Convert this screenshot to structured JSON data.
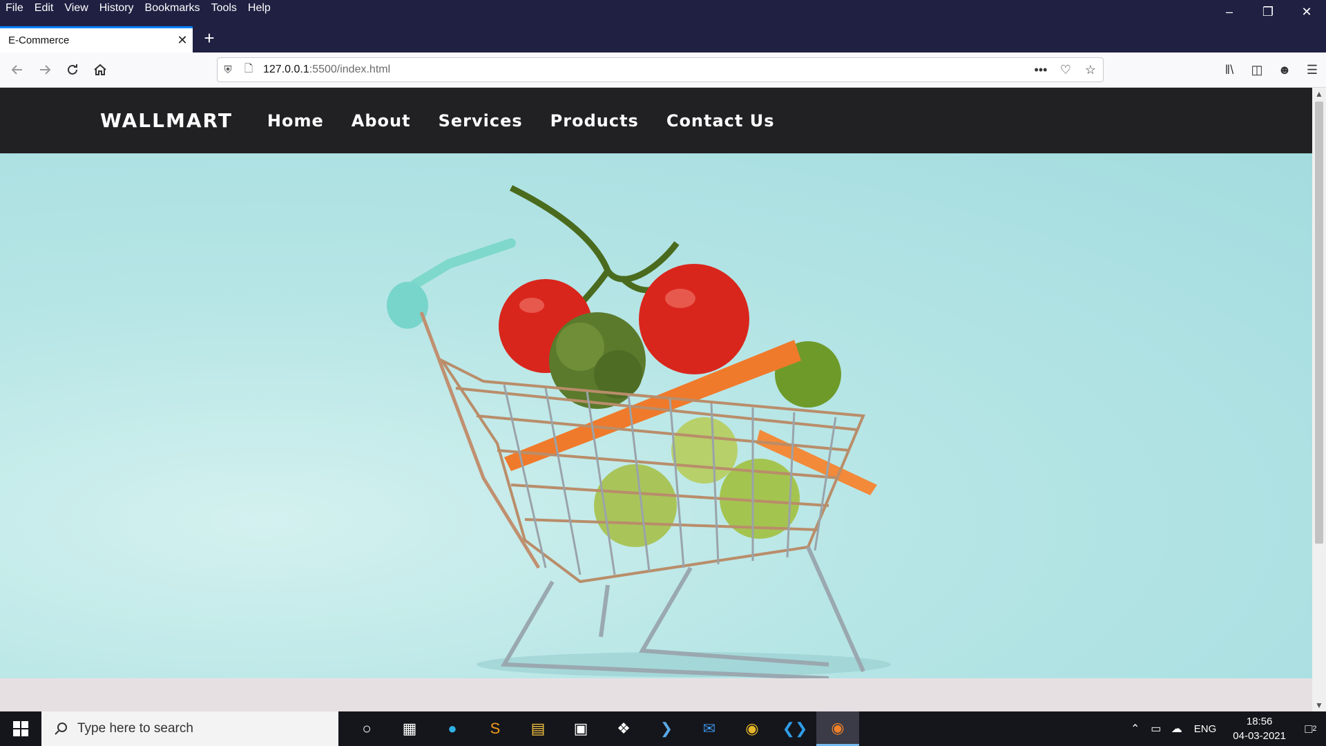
{
  "browser": {
    "menu": [
      "File",
      "Edit",
      "View",
      "History",
      "Bookmarks",
      "Tools",
      "Help"
    ],
    "tab_title": "E-Commerce",
    "url_host": "127.0.0.1",
    "url_path": ":5500/index.html"
  },
  "site": {
    "brand": "WALLMART",
    "nav": [
      "Home",
      "About",
      "Services",
      "Products",
      "Contact Us"
    ]
  },
  "taskbar": {
    "search_placeholder": "Type here to search",
    "lang": "ENG",
    "time": "18:56",
    "date": "04-03-2021",
    "notification_count": "2"
  },
  "colors": {
    "titlebar": "#1f2042",
    "site_nav": "#212123",
    "hero_bg": "#b8e6e6",
    "accent": "#0a84ff"
  }
}
